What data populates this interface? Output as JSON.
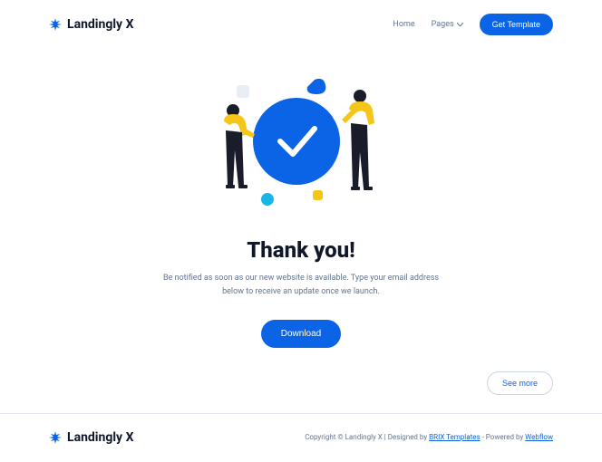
{
  "brand": {
    "name": "Landingly X"
  },
  "nav": {
    "home": "Home",
    "pages": "Pages",
    "cta": "Get Template"
  },
  "hero": {
    "title": "Thank you!",
    "subtitle_line1": "Be notified as soon as our new website is available. Type your email address",
    "subtitle_line2": "below to receive an update once we launch.",
    "download": "Download",
    "see_more": "See more"
  },
  "footer": {
    "copyright": "Copyright © Landingly X | Designed by ",
    "link1": "BRIX Templates",
    "mid": " - Powered by ",
    "link2": "Webflow"
  },
  "colors": {
    "primary": "#0b63e5",
    "accent_yellow": "#f5c518",
    "accent_cyan": "#18b6e6"
  }
}
